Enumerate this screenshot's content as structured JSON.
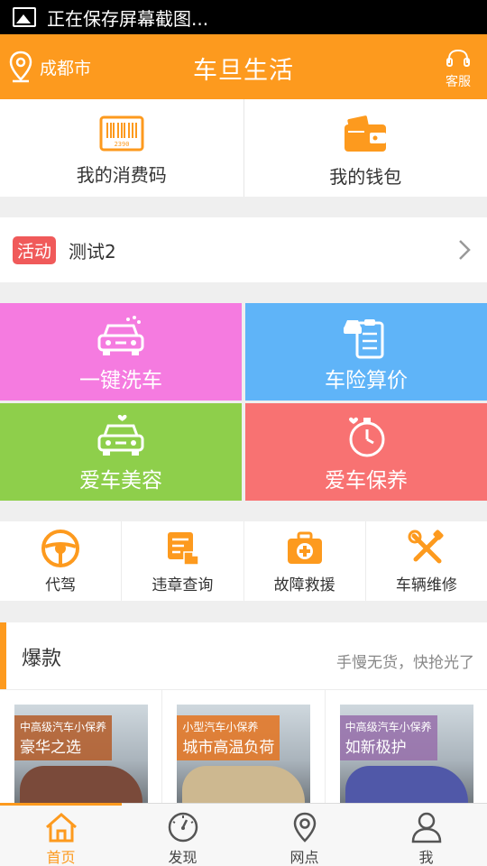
{
  "status_bar": {
    "text": "正在保存屏幕截图..."
  },
  "header": {
    "location": "成都市",
    "title": "车旦生活",
    "service_label": "客服"
  },
  "wallet": {
    "consume_code_label": "我的消费码",
    "wallet_label": "我的钱包",
    "barcode_digits": "2390"
  },
  "activity": {
    "tag": "活动",
    "text": "测试2"
  },
  "tiles": [
    {
      "label": "一键洗车",
      "color": "#f57be0",
      "icon": "car-wash-icon"
    },
    {
      "label": "车险算价",
      "color": "#5fb4f8",
      "icon": "insurance-clipboard-icon"
    },
    {
      "label": "爱车美容",
      "color": "#8ecf4b",
      "icon": "car-heart-icon"
    },
    {
      "label": "爱车保养",
      "color": "#f87272",
      "icon": "stopwatch-heart-icon"
    }
  ],
  "services": [
    {
      "label": "代驾",
      "icon": "steering-wheel-icon"
    },
    {
      "label": "违章查询",
      "icon": "violation-query-icon"
    },
    {
      "label": "故障救援",
      "icon": "first-aid-kit-icon"
    },
    {
      "label": "车辆维修",
      "icon": "wrench-screwdriver-icon"
    }
  ],
  "hot": {
    "title": "爆款",
    "subtitle": "手慢无货，快抢光了"
  },
  "products": [
    {
      "small": "中高级汽车小保养",
      "big": "豪华之选"
    },
    {
      "small": "小型汽车小保养",
      "big": "城市高温负荷"
    },
    {
      "small": "中高级汽车小保养",
      "big": "如新极护"
    }
  ],
  "tabbar": [
    {
      "label": "首页",
      "active": true,
      "icon": "home-icon"
    },
    {
      "label": "发现",
      "active": false,
      "icon": "compass-icon"
    },
    {
      "label": "网点",
      "active": false,
      "icon": "map-pin-icon"
    },
    {
      "label": "我",
      "active": false,
      "icon": "user-icon"
    }
  ],
  "colors": {
    "accent": "#fd9a1e",
    "activity_tag": "#f05a5a"
  }
}
